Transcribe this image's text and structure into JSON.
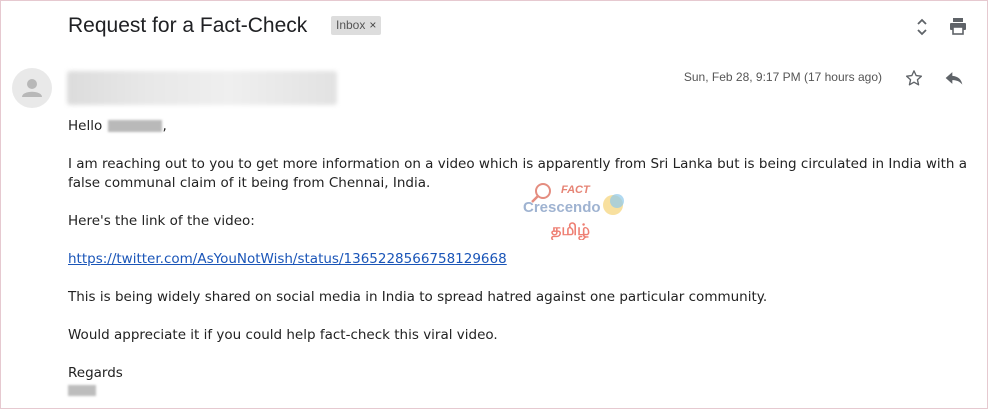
{
  "header": {
    "subject": "Request for a Fact-Check",
    "label_chip": "Inbox",
    "label_remove": "×"
  },
  "message": {
    "date": "Sun, Feb 28, 9:17 PM (17 hours ago)",
    "greeting_prefix": "Hello",
    "greeting_suffix": ",",
    "paragraphs": [
      "I am reaching out to you to get more information on a video which is apparently from Sri Lanka but is being circulated in India with a false communal claim of it being from Chennai, India.",
      "Here's the link of the video:"
    ],
    "link": "https://twitter.com/AsYouNotWish/status/1365228566758129668",
    "paragraphs_after": [
      "This is being widely shared on social media in India to spread hatred against one particular community.",
      "Would appreciate it if you could help fact-check this viral video."
    ],
    "signoff": "Regards"
  },
  "watermark": {
    "top": "FACT",
    "middle": "Crescendo",
    "bottom": "தமிழ்"
  },
  "icons": {
    "expand": "unfold-icon",
    "print": "print-icon",
    "star": "star-icon",
    "reply": "reply-icon",
    "avatar": "person-icon"
  }
}
